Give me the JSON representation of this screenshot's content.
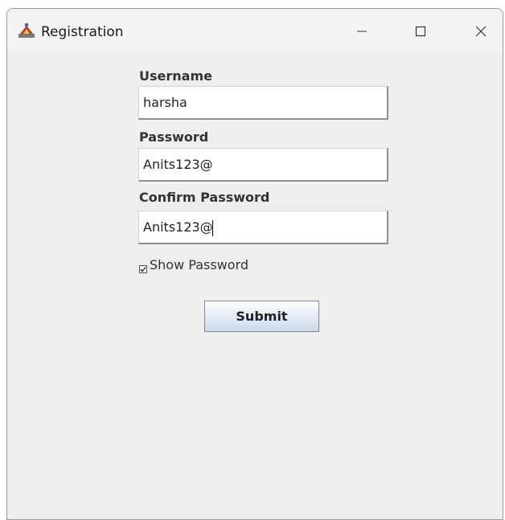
{
  "window": {
    "title": "Registration",
    "app_icon": "java-app-icon",
    "controls": {
      "minimize_icon": "minimize-icon",
      "maximize_icon": "maximize-icon",
      "close_icon": "close-icon"
    }
  },
  "form": {
    "username": {
      "label": "Username",
      "value": "harsha"
    },
    "password": {
      "label": "Password",
      "value": "Anits123@"
    },
    "confirm_password": {
      "label": "Confirm Password",
      "value": "Anits123@"
    },
    "show_password": {
      "label": "Show Password",
      "checked": true
    },
    "submit_label": "Submit"
  },
  "colors": {
    "window_bg": "#eeeeee",
    "titlebar_bg": "#f3f3f3",
    "button_gradient_bottom": "#cfdbeb"
  }
}
